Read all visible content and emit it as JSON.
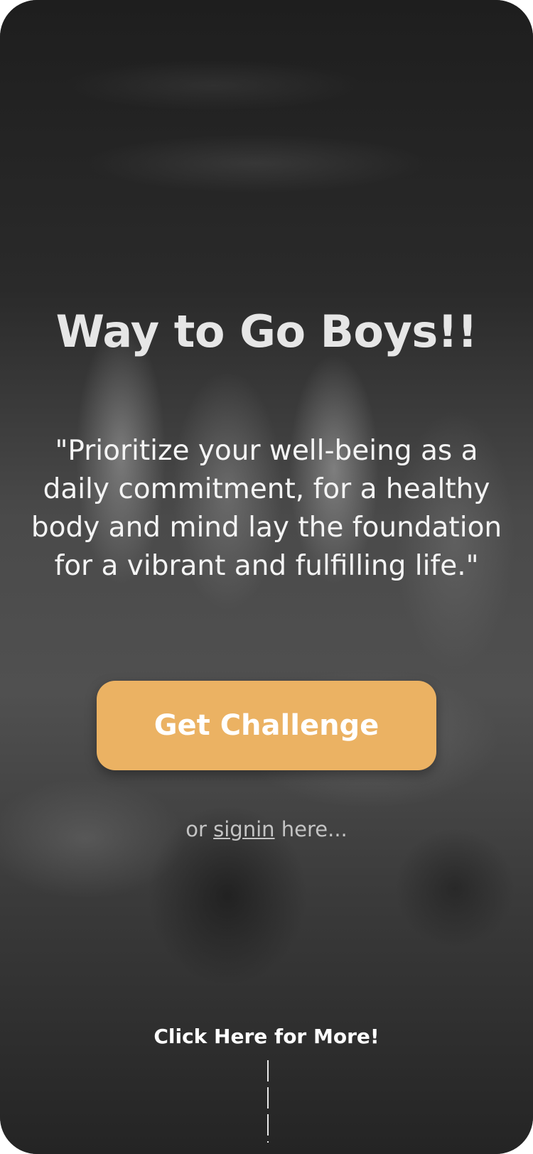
{
  "hero": {
    "title": "Way to Go Boys!!",
    "quote": "\"Prioritize your well-being as a daily commitment, for a healthy body and mind lay the foundation for a vibrant and fulfilling life.\""
  },
  "cta": {
    "label": "Get Challenge",
    "color": "#ebb263"
  },
  "signin": {
    "prefix": "or ",
    "link_label": "signin",
    "suffix": " here..."
  },
  "more": {
    "label": "Click Here for More!"
  }
}
